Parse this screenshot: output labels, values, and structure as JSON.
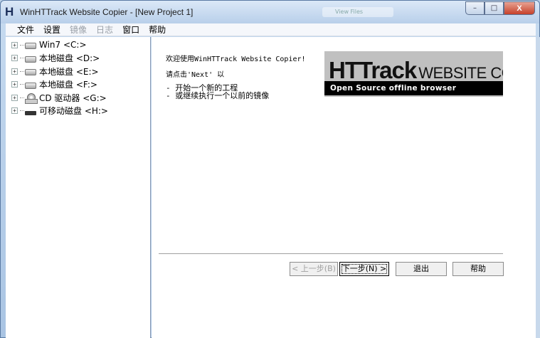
{
  "window": {
    "title": "WinHTTrack Website Copier - [New Project 1]",
    "app_icon_glyph": "H",
    "bg_window_label": "View Files",
    "minimize": "–",
    "maximize": "□",
    "close": "X"
  },
  "menu": {
    "items": [
      {
        "label": "文件",
        "enabled": true
      },
      {
        "label": "设置",
        "enabled": true
      },
      {
        "label": "镜像",
        "enabled": false
      },
      {
        "label": "日志",
        "enabled": false
      },
      {
        "label": "窗口",
        "enabled": true
      },
      {
        "label": "帮助",
        "enabled": true
      }
    ]
  },
  "tree": {
    "drives": [
      {
        "label": "Win7 <C:>",
        "icon": "hard-drive-icon"
      },
      {
        "label": "本地磁盘 <D:>",
        "icon": "hard-drive-icon"
      },
      {
        "label": "本地磁盘 <E:>",
        "icon": "hard-drive-icon"
      },
      {
        "label": "本地磁盘 <F:>",
        "icon": "hard-drive-icon"
      },
      {
        "label": "CD 驱动器 <G:>",
        "icon": "cd-drive-icon"
      },
      {
        "label": "可移动磁盘 <H:>",
        "icon": "usb-drive-icon"
      }
    ],
    "expander_glyph": "+"
  },
  "wizard": {
    "welcome": "欢迎使用WinHTTrack Website Copier!",
    "instruction": "请点击'Next' 以",
    "bullet_1": "- 开始一个新的工程",
    "bullet_2": "- 或继续执行一个以前的镜像",
    "banner_httrack": "HTTrack",
    "banner_website": "WEBSITE COPIER",
    "banner_tagline": "Open Source offline browser"
  },
  "buttons": {
    "prev": "< 上一步(B)",
    "next": "下一步(N) >",
    "exit": "退出",
    "help": "帮助"
  }
}
